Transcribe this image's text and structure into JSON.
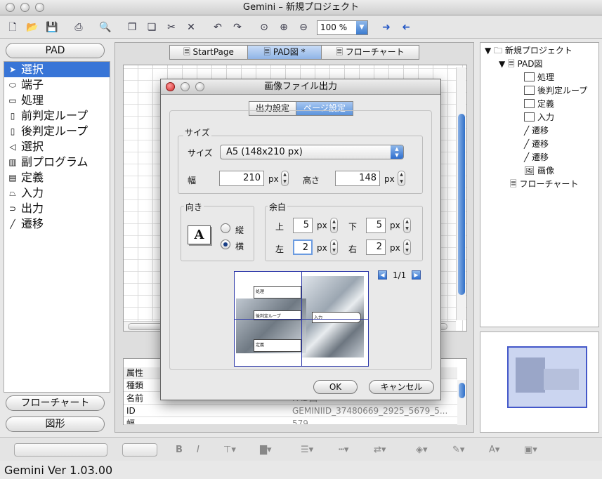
{
  "window": {
    "title": "Gemini – 新規プロジェクト"
  },
  "toolbar": {
    "zoom": "100 %"
  },
  "palette": {
    "header": "PAD",
    "items": [
      {
        "label": "選択",
        "icon": "pointer-arrow-icon"
      },
      {
        "label": "端子",
        "icon": "terminal-shape-icon"
      },
      {
        "label": "処理",
        "icon": "process-shape-icon"
      },
      {
        "label": "前判定ループ",
        "icon": "pre-loop-shape-icon"
      },
      {
        "label": "後判定ループ",
        "icon": "post-loop-shape-icon"
      },
      {
        "label": "選択",
        "icon": "selection-shape-icon"
      },
      {
        "label": "副プログラム",
        "icon": "subprogram-shape-icon"
      },
      {
        "label": "定義",
        "icon": "definition-shape-icon"
      },
      {
        "label": "入力",
        "icon": "input-shape-icon"
      },
      {
        "label": "出力",
        "icon": "output-shape-icon"
      },
      {
        "label": "遷移",
        "icon": "transition-line-icon"
      }
    ],
    "buttons": {
      "flowchart": "フローチャート",
      "shape": "図形"
    }
  },
  "center_tabs": [
    "StartPage",
    "PAD図 *",
    "フローチャート"
  ],
  "properties": {
    "header": "属性",
    "rows": [
      {
        "key": "種類",
        "value": ""
      },
      {
        "key": "名前",
        "value": "PAD図"
      },
      {
        "key": "ID",
        "value": "GEMINIID_37480669_2925_5679_5..."
      },
      {
        "key": "幅",
        "value": "579"
      }
    ]
  },
  "tree": {
    "root": "新規プロジェクト",
    "pad": "PAD図",
    "children": [
      "処理",
      "後判定ループ",
      "定義",
      "入力",
      "遷移",
      "遷移",
      "遷移",
      "画像"
    ],
    "flowchart": "フローチャート"
  },
  "status": "Gemini  Ver 1.03.00",
  "dialog": {
    "title": "画像ファイル出力",
    "tabs": [
      "出力設定",
      "ページ設定"
    ],
    "size_group": "サイズ",
    "size_label": "サイズ",
    "size_value": "A5 (148x210 px)",
    "width_label": "幅",
    "width_value": "210",
    "height_label": "高さ",
    "height_value": "148",
    "unit": "px",
    "orientation_group": "向き",
    "portrait": "縦",
    "landscape": "横",
    "orientation_selected": "横",
    "orientation_glyph": "A",
    "margin_group": "余白",
    "margin": {
      "top_label": "上",
      "top": "5",
      "bottom_label": "下",
      "bottom": "5",
      "left_label": "左",
      "left": "2",
      "right_label": "右",
      "right": "2"
    },
    "page_indicator": "1/1",
    "preview_labels": [
      "処理",
      "後判定ループ",
      "入力",
      "定義"
    ],
    "ok": "OK",
    "cancel": "キャンセル"
  },
  "colors": {
    "selection": "#3875d7",
    "accent": "#2b36a8"
  }
}
